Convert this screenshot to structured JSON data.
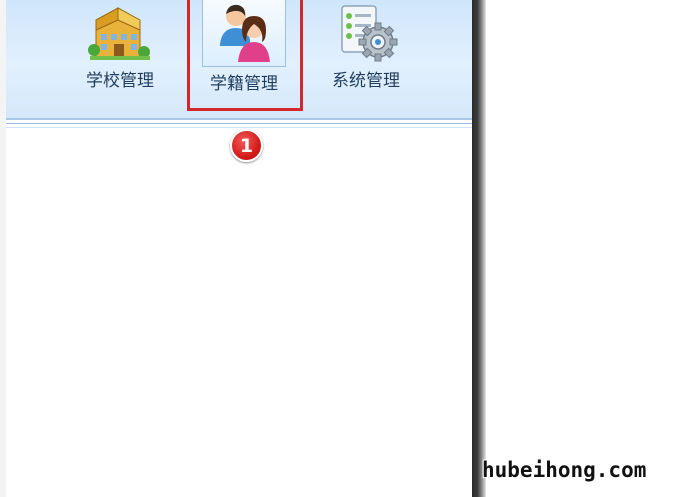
{
  "toolbar": {
    "items": [
      {
        "label": "学校管理",
        "icon": "school-building-icon"
      },
      {
        "label": "学籍管理",
        "icon": "students-icon",
        "selected": true
      },
      {
        "label": "系统管理",
        "icon": "system-settings-icon"
      }
    ]
  },
  "annotation": {
    "step_number": "1",
    "color": "#d3282b"
  },
  "watermark": "hubeihong.com",
  "colors": {
    "toolbar_bg": "#dcedfc",
    "label_text": "#1f3e5e",
    "highlight": "#d3282b"
  }
}
